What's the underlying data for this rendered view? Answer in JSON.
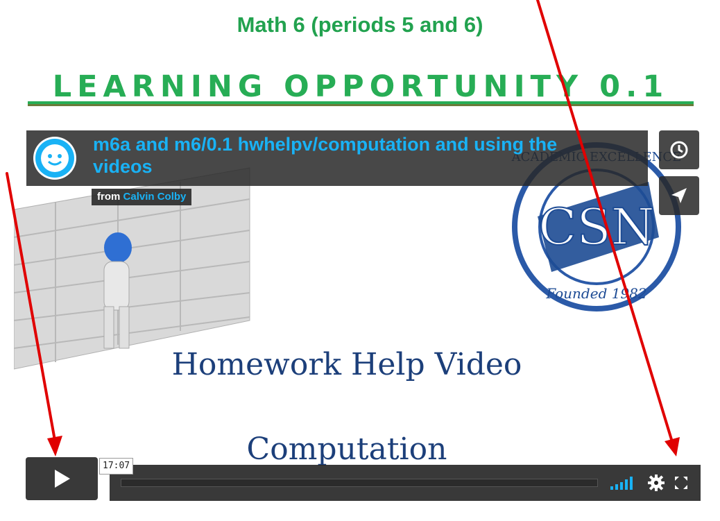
{
  "page": {
    "course_title": "Math 6 (periods 5 and 6)",
    "heading": "LEARNING OPPORTUNITY 0.1"
  },
  "video": {
    "title": "m6a and m6/0.1 hwhelpv/computation and using the videos",
    "byline_prefix": "from",
    "author": "Calvin Colby",
    "slide_text_line1": "Homework Help Video",
    "slide_text_line2": "Computation",
    "logo_text_top": "ACADEMIC EXCELLENCE",
    "logo_text_bottom": "Founded 1982",
    "logo_monogram": "CSN",
    "duration_tooltip": "17:07",
    "progress": 0
  },
  "controls": {
    "play_icon": "play-icon",
    "watch_later_icon": "clock-icon",
    "share_icon": "paper-plane-icon",
    "volume_icon": "volume-bars-icon",
    "settings_icon": "gear-icon",
    "fullscreen_icon": "fullscreen-icon"
  },
  "colors": {
    "heading_green": "#27ad55",
    "accent_blue": "#19b2f5",
    "annotation_red": "#e00000",
    "slide_text_blue": "#1c3f7a"
  }
}
